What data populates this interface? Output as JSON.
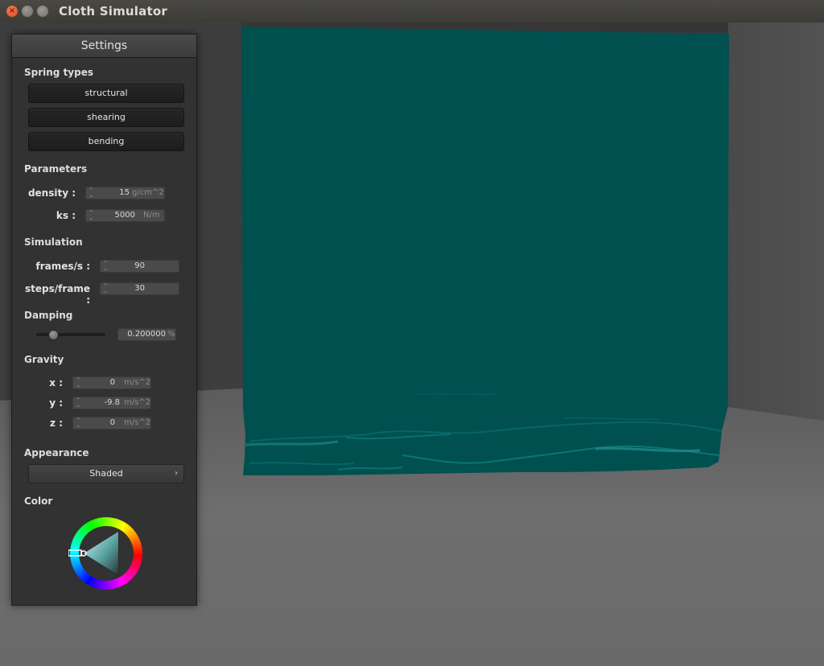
{
  "window": {
    "title": "Cloth Simulator",
    "close_glyph": "×",
    "min_glyph": "–",
    "max_glyph": "□"
  },
  "panel": {
    "title": "Settings",
    "spring_types": {
      "heading": "Spring types",
      "buttons": [
        "structural",
        "shearing",
        "bending"
      ]
    },
    "parameters": {
      "heading": "Parameters",
      "density": {
        "label": "density :",
        "value": "15",
        "unit": "g/cm^2"
      },
      "ks": {
        "label": "ks :",
        "value": "5000",
        "unit": "N/m"
      }
    },
    "simulation": {
      "heading": "Simulation",
      "fps": {
        "label": "frames/s :",
        "value": "90"
      },
      "steps": {
        "label": "steps/frame :",
        "value": "30"
      }
    },
    "damping": {
      "heading": "Damping",
      "value": "0.200000",
      "unit": "%",
      "slider_fraction": 0.2
    },
    "gravity": {
      "heading": "Gravity",
      "x": {
        "label": "x :",
        "value": "0",
        "unit": "m/s^2"
      },
      "y": {
        "label": "y :",
        "value": "-9.8",
        "unit": "m/s^2"
      },
      "z": {
        "label": "z :",
        "value": "0",
        "unit": "m/s^2"
      }
    },
    "appearance": {
      "heading": "Appearance",
      "selected": "Shaded",
      "chevron": "›"
    },
    "color": {
      "heading": "Color",
      "selected_hex": "#005050"
    }
  },
  "scene": {
    "cloth_color": "#005050",
    "floor_color": "#6c6c6c",
    "wall_color": "#3c3c3c"
  }
}
